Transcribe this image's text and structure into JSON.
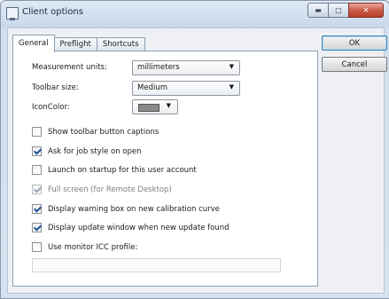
{
  "window": {
    "title": "Client options",
    "controls": {
      "minimize": "▬",
      "maximize": "□",
      "close": "✕"
    }
  },
  "tabs": [
    {
      "label": "General",
      "active": true
    },
    {
      "label": "Preflight",
      "active": false
    },
    {
      "label": "Shortcuts",
      "active": false
    }
  ],
  "fields": {
    "measurement_label": "Measurement units:",
    "measurement_value": "millimeters",
    "toolbar_label": "Toolbar size:",
    "toolbar_value": "Medium",
    "iconcolor_label": "IconColor:",
    "iconcolor_value": "#8b8b8b",
    "dropdown_arrow": "▼"
  },
  "checkboxes": [
    {
      "label": "Show toolbar button captions",
      "checked": false,
      "disabled": false
    },
    {
      "label": "Ask for job style on open",
      "checked": true,
      "disabled": false
    },
    {
      "label": "Launch on startup for this user account",
      "checked": false,
      "disabled": false
    },
    {
      "label": "Full screen (for Remote Desktop)",
      "checked": true,
      "disabled": true
    },
    {
      "label": "Display warning box on new calibration curve",
      "checked": true,
      "disabled": false
    },
    {
      "label": "Display update window when new update found",
      "checked": true,
      "disabled": false
    },
    {
      "label": "Use monitor ICC profile:",
      "checked": false,
      "disabled": false
    }
  ],
  "icc_profile_value": "",
  "buttons": {
    "ok": "OK",
    "cancel": "Cancel"
  }
}
